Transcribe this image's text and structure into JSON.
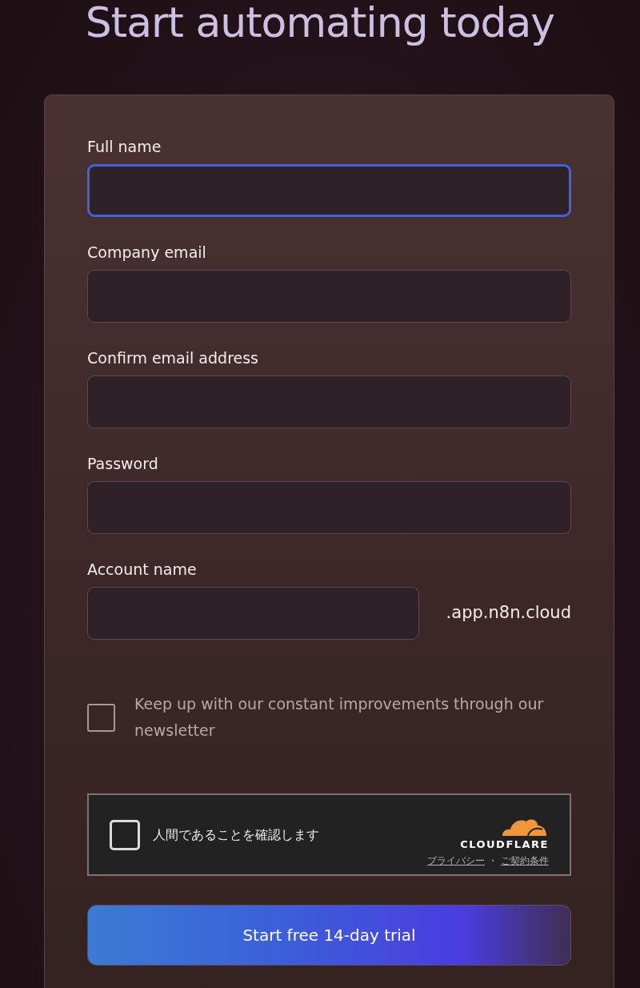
{
  "title": "Start automating today",
  "fields": [
    {
      "label": "Full name",
      "focused": true
    },
    {
      "label": "Company email",
      "focused": false
    },
    {
      "label": "Confirm email address",
      "focused": false
    },
    {
      "label": "Password",
      "focused": false
    },
    {
      "label": "Account name",
      "focused": false,
      "suffix": ".app.n8n.cloud"
    }
  ],
  "newsletter": {
    "label": "Keep up with our constant improvements through our newsletter",
    "checked": false
  },
  "captcha": {
    "label": "人間であることを確認します",
    "checked": false,
    "brand": "CLOUDFLARE",
    "links": [
      "プライバシー",
      "ご契約条件"
    ],
    "separator": "・"
  },
  "submit": "Start free 14-day trial"
}
